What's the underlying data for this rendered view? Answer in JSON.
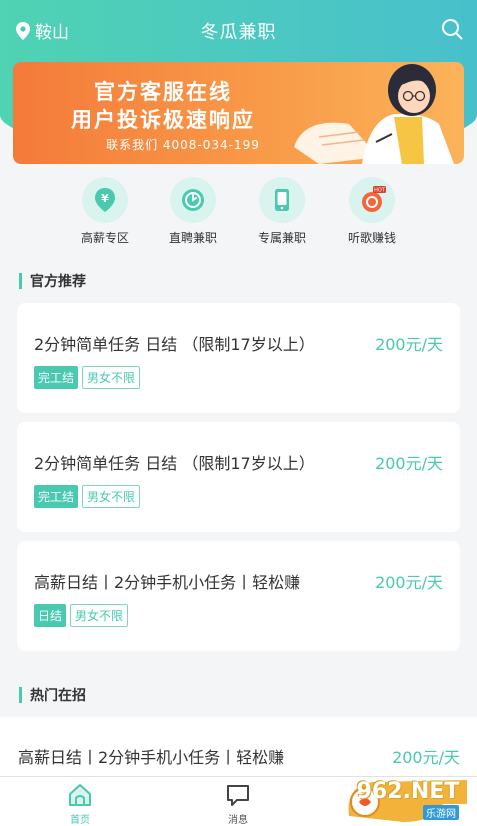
{
  "header": {
    "location": "鞍山",
    "title": "冬瓜兼职"
  },
  "banner": {
    "line1": "官方客服在线",
    "line2": "用户投诉极速响应",
    "line3": "联系我们 4008-034-199"
  },
  "categories": [
    {
      "label": "高薪专区",
      "icon": "yen-location-icon"
    },
    {
      "label": "直聘兼职",
      "icon": "clock-check-icon"
    },
    {
      "label": "专属兼职",
      "icon": "phone-icon"
    },
    {
      "label": "听歌赚钱",
      "icon": "hot-music-icon"
    }
  ],
  "sections": {
    "recommended": "官方推荐",
    "hot": "热门在招"
  },
  "jobs": [
    {
      "title": "2分钟简单任务 日结 （限制17岁以上）",
      "salary": "200元/天",
      "tag1": "完工结",
      "tag2": "男女不限"
    },
    {
      "title": "2分钟简单任务 日结 （限制17岁以上）",
      "salary": "200元/天",
      "tag1": "完工结",
      "tag2": "男女不限"
    },
    {
      "title": "高薪日结丨2分钟手机小任务丨轻松赚",
      "salary": "200元/天",
      "tag1": "日结",
      "tag2": "男女不限"
    }
  ],
  "hot_jobs": [
    {
      "title": "高薪日结丨2分钟手机小任务丨轻松赚",
      "salary": "200元/天"
    }
  ],
  "tabbar": {
    "home": "首页",
    "messages": "消息"
  },
  "watermark": {
    "brand": "962.NET",
    "sub": "乐游网"
  },
  "colors": {
    "accent": "#48c9b0",
    "banner": "#f7883e"
  }
}
